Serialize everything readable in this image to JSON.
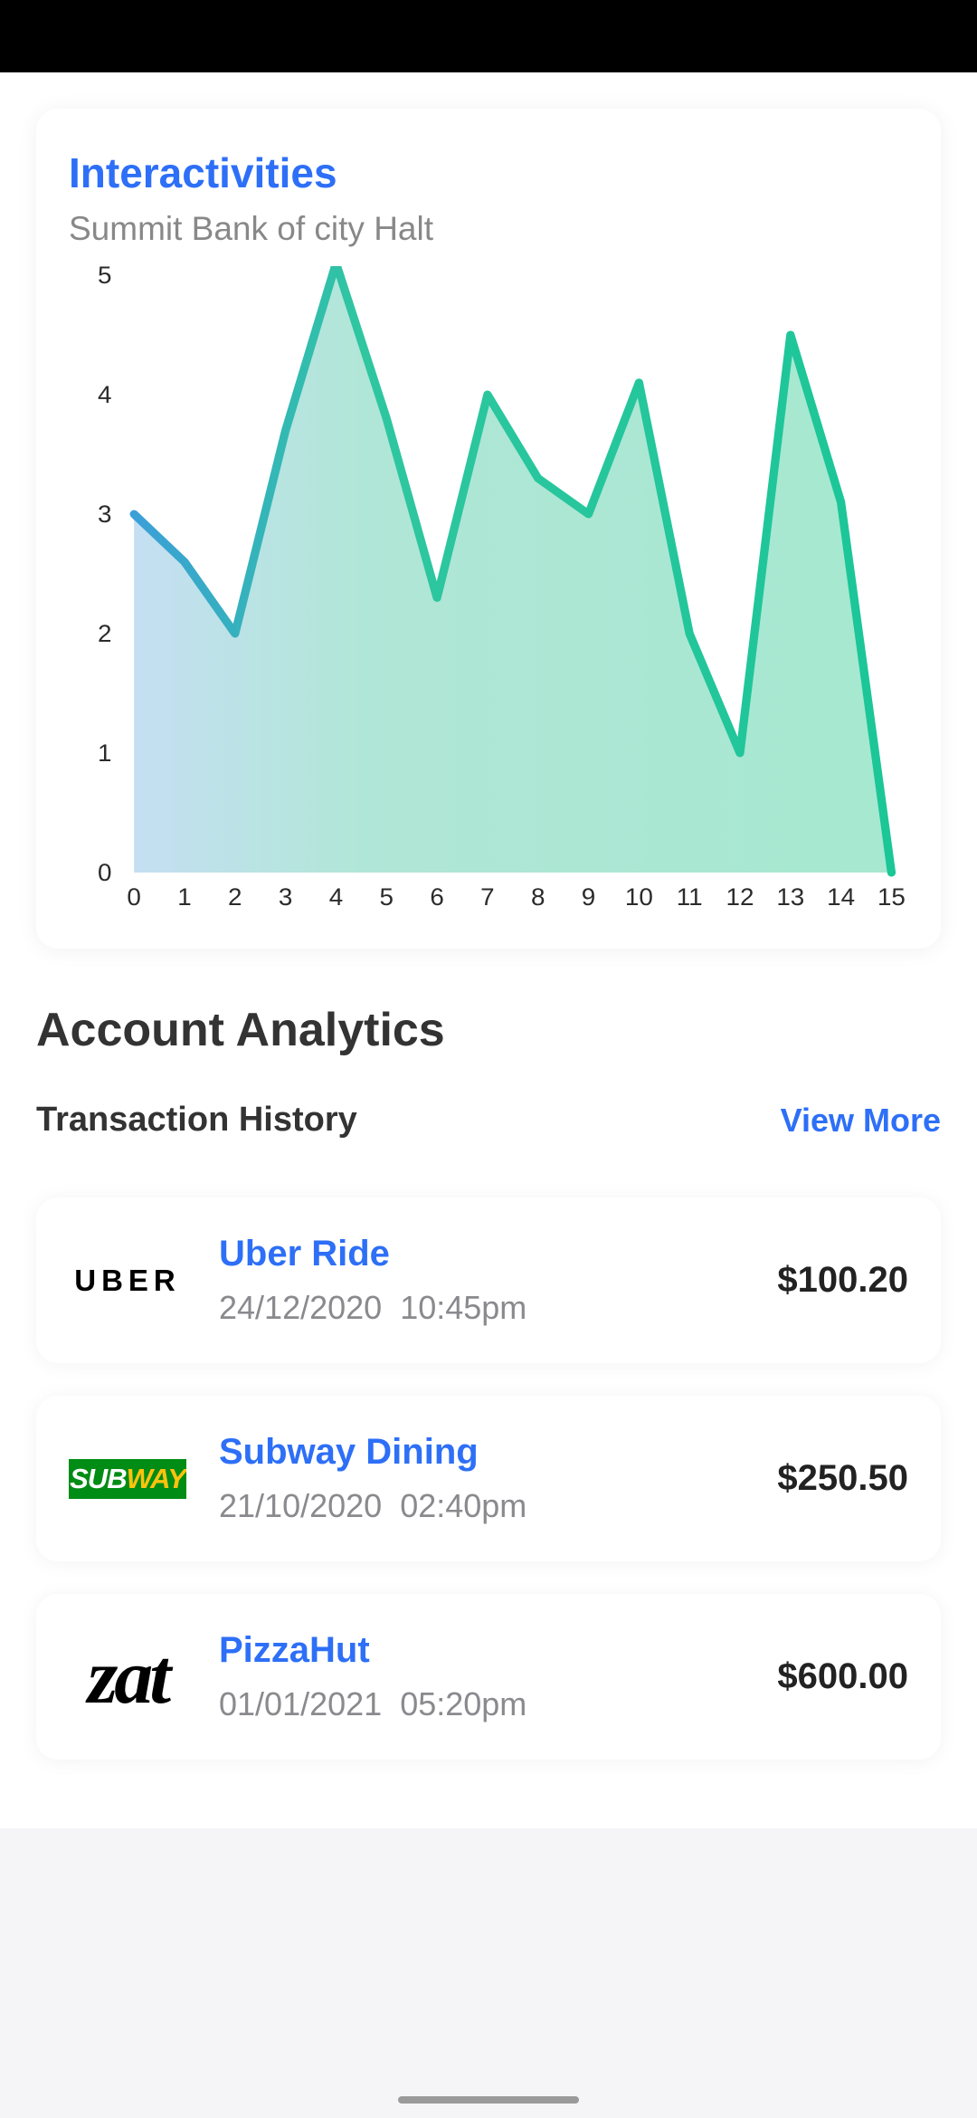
{
  "chart_card": {
    "title": "Interactivities",
    "subtitle": "Summit Bank of city Halt"
  },
  "chart_data": {
    "type": "area",
    "x": [
      0,
      1,
      2,
      3,
      4,
      5,
      6,
      7,
      8,
      9,
      10,
      11,
      12,
      13,
      14,
      15
    ],
    "values": [
      3.0,
      2.6,
      2.0,
      3.7,
      5.1,
      3.8,
      2.3,
      4.0,
      3.3,
      3.0,
      4.1,
      2.0,
      1.0,
      4.5,
      3.1,
      0.0
    ],
    "title": "Interactivities",
    "xlabel": "",
    "ylabel": "",
    "xlim": [
      0,
      15
    ],
    "ylim": [
      0,
      5
    ],
    "xticks": [
      0,
      1,
      2,
      3,
      4,
      5,
      6,
      7,
      8,
      9,
      10,
      11,
      12,
      13,
      14,
      15
    ],
    "yticks": [
      0,
      1,
      2,
      3,
      4,
      5
    ]
  },
  "section": {
    "title": "Account Analytics"
  },
  "list_header": {
    "title": "Transaction History",
    "view_more": "View More"
  },
  "transactions": [
    {
      "name": "Uber Ride",
      "date": "24/12/2020",
      "time": "10:45pm",
      "amount": "$100.20",
      "logo": "uber"
    },
    {
      "name": "Subway Dining",
      "date": "21/10/2020",
      "time": "02:40pm",
      "amount": "$250.50",
      "logo": "subway"
    },
    {
      "name": "PizzaHut",
      "date": "01/01/2021",
      "time": "05:20pm",
      "amount": "$600.00",
      "logo": "pizzahut"
    }
  ],
  "logo_text": {
    "uber": "UBER",
    "subway_white": "SUB",
    "subway_yellow": "WAY",
    "pizzahut": "zat"
  }
}
